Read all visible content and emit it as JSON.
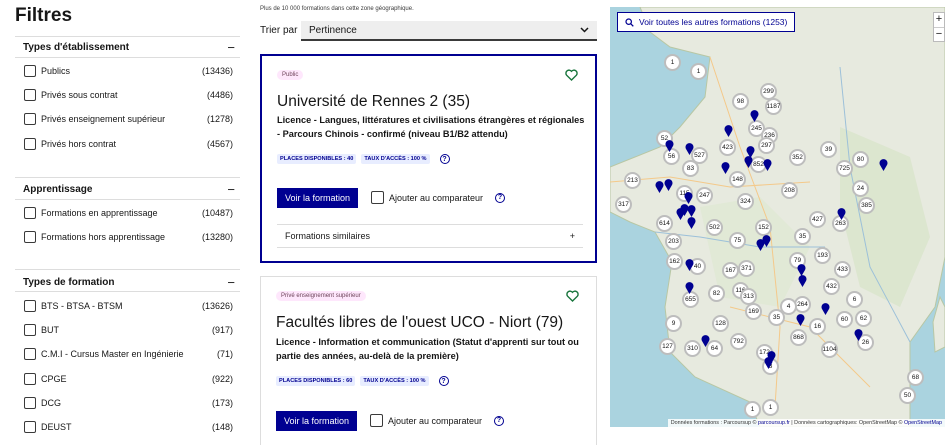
{
  "filters": {
    "title": "Filtres",
    "groups": [
      {
        "title": "Types d'établissement",
        "collapse_icon": "−",
        "options": [
          {
            "label": "Publics",
            "count": "(13436)"
          },
          {
            "label": "Privés sous contrat",
            "count": "(4486)"
          },
          {
            "label": "Privés enseignement supérieur",
            "count": "(1278)"
          },
          {
            "label": "Privés hors contrat",
            "count": "(4567)"
          }
        ]
      },
      {
        "title": "Apprentissage",
        "collapse_icon": "−",
        "options": [
          {
            "label": "Formations en apprentissage",
            "count": "(10487)"
          },
          {
            "label": "Formations hors apprentissage",
            "count": "(13280)"
          }
        ]
      },
      {
        "title": "Types de formation",
        "collapse_icon": "−",
        "options": [
          {
            "label": "BTS - BTSA - BTSM",
            "count": "(13626)"
          },
          {
            "label": "BUT",
            "count": "(917)"
          },
          {
            "label": "C.M.I - Cursus Master en Ingénierie",
            "count": "(71)"
          },
          {
            "label": "CPGE",
            "count": "(922)"
          },
          {
            "label": "DCG",
            "count": "(173)"
          },
          {
            "label": "DEUST",
            "count": "(148)"
          }
        ]
      }
    ]
  },
  "results": {
    "zone_note": "Plus de 10 000 formations dans cette zone géographique.",
    "sort_label": "Trier par",
    "sort_value": "Pertinence",
    "cards": [
      {
        "tag": "Public",
        "title": "Université de Rennes 2 (35)",
        "subtitle": "Licence - Langues, littératures et civilisations étrangères et régionales - Parcours Chinois - confirmé (niveau B1/B2 attendu)",
        "places": "PLACES DISPONIBLES : 40",
        "taux": "TAUX D'ACCÈS : 100 %",
        "cta": "Voir la formation",
        "compare": "Ajouter au comparateur",
        "similar": "Formations similaires",
        "similar_icon": "+"
      },
      {
        "tag": "Privé enseignement supérieur",
        "title": "Facultés libres de l'ouest UCO - Niort (79)",
        "subtitle": "Licence - Information et communication (Statut d'apprenti sur tout ou partie des années, au-delà de la première)",
        "places": "PLACES DISPONIBLES : 60",
        "taux": "TAUX D'ACCÈS : 100 %",
        "cta": "Voir la formation",
        "compare": "Ajouter au comparateur"
      }
    ]
  },
  "map": {
    "button_label": "Voir toutes les autres formations (1253)",
    "zoom_in": "+",
    "zoom_out": "−",
    "attribution": {
      "prefix": "Données formations : Parcoursup © ",
      "link1": "parcoursup.fr",
      "middle": " | Données cartographiques: OpenStreetMap © ",
      "link2": "OpenStreetMap"
    },
    "clusters": [
      "1",
      "1",
      "98",
      "299",
      "1187",
      "423",
      "245",
      "527",
      "236",
      "52",
      "297",
      "56",
      "39",
      "83",
      "725",
      "852",
      "352",
      "80",
      "213",
      "148",
      "247",
      "115",
      "324",
      "208",
      "317",
      "24",
      "385",
      "427",
      "263",
      "614",
      "502",
      "152",
      "75",
      "35",
      "203",
      "162",
      "193",
      "40",
      "371",
      "167",
      "79",
      "433",
      "6",
      "432",
      "116",
      "82",
      "313",
      "62",
      "264",
      "655",
      "4",
      "9",
      "169",
      "35",
      "60",
      "16",
      "128",
      "127",
      "310",
      "64",
      "792",
      "868",
      "26",
      "172",
      "1104",
      "3",
      "68",
      "50",
      "1",
      "1"
    ],
    "pin_color": "#000091"
  }
}
